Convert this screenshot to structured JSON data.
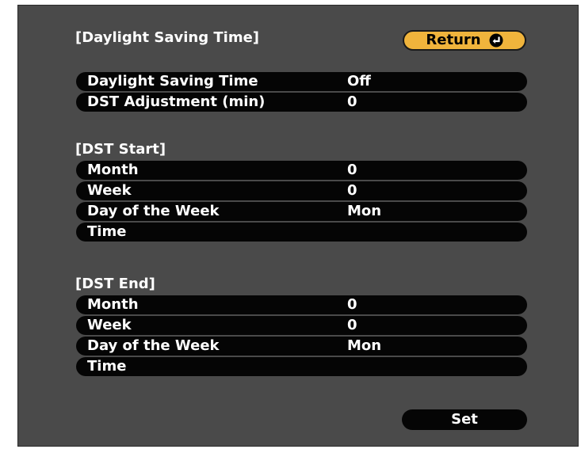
{
  "header": {
    "title": "[Daylight Saving Time]",
    "return_label": "Return"
  },
  "dst_general": [
    {
      "label": "Daylight Saving Time",
      "value": "Off"
    },
    {
      "label": "DST Adjustment (min)",
      "value": "0"
    }
  ],
  "dst_start": {
    "title": "[DST Start]",
    "rows": [
      {
        "label": "Month",
        "value": "0"
      },
      {
        "label": "Week",
        "value": "0"
      },
      {
        "label": "Day of the Week",
        "value": "Mon"
      },
      {
        "label": "Time",
        "value": ""
      }
    ]
  },
  "dst_end": {
    "title": "[DST End]",
    "rows": [
      {
        "label": "Month",
        "value": "0"
      },
      {
        "label": "Week",
        "value": "0"
      },
      {
        "label": "Day of the Week",
        "value": "Mon"
      },
      {
        "label": "Time",
        "value": ""
      }
    ]
  },
  "footer": {
    "set_label": "Set"
  },
  "colors": {
    "panel_bg": "#4a4a4a",
    "row_bg": "#050505",
    "accent": "#f0b43c",
    "text": "#ffffff"
  }
}
